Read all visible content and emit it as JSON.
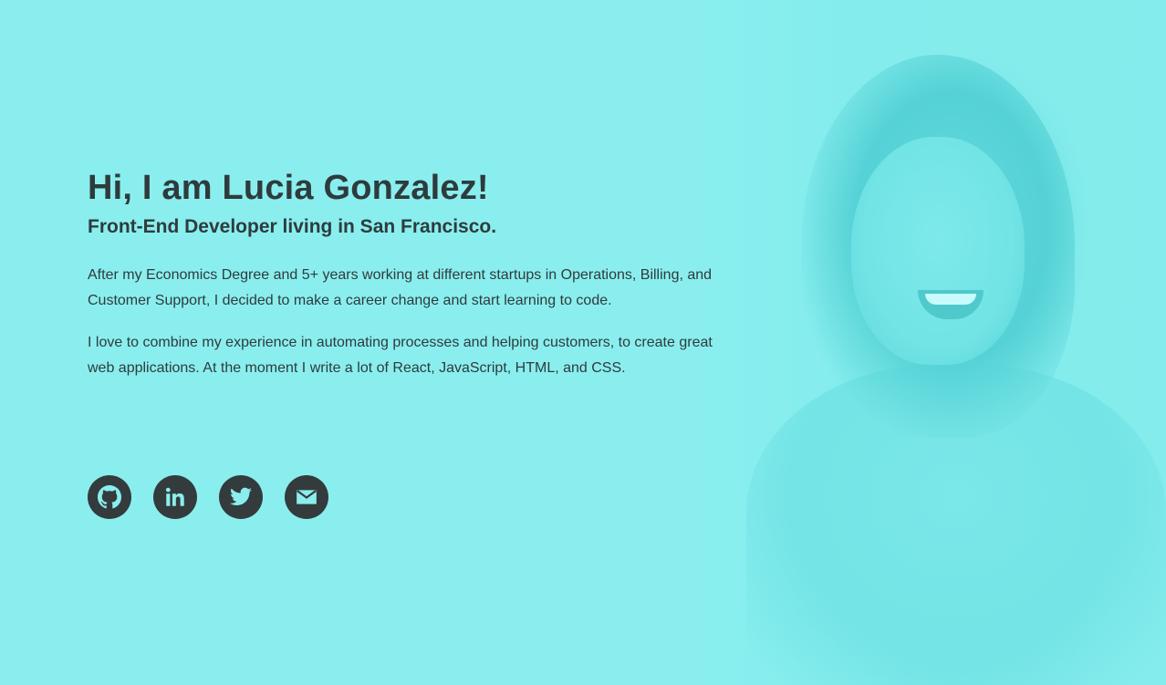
{
  "hero": {
    "title": "Hi, I am Lucia Gonzalez!",
    "subtitle": "Front-End Developer living in San Francisco.",
    "paragraphs": [
      "After my Economics Degree and 5+ years working at different startups in Operations, Billing, and Customer Support, I decided to make a career change and start learning to code.",
      "I love to combine my experience in automating processes and helping customers, to create great web applications. At the moment I write a lot of React, JavaScript, HTML, and CSS."
    ]
  },
  "social": [
    {
      "icon": "github-icon"
    },
    {
      "icon": "linkedin-icon"
    },
    {
      "icon": "twitter-icon"
    },
    {
      "icon": "email-icon"
    }
  ],
  "colors": {
    "background": "#8aeeee",
    "text": "#2e3b3d",
    "icon_circle": "#343b3c",
    "icon_glyph": "#8aeeee"
  }
}
